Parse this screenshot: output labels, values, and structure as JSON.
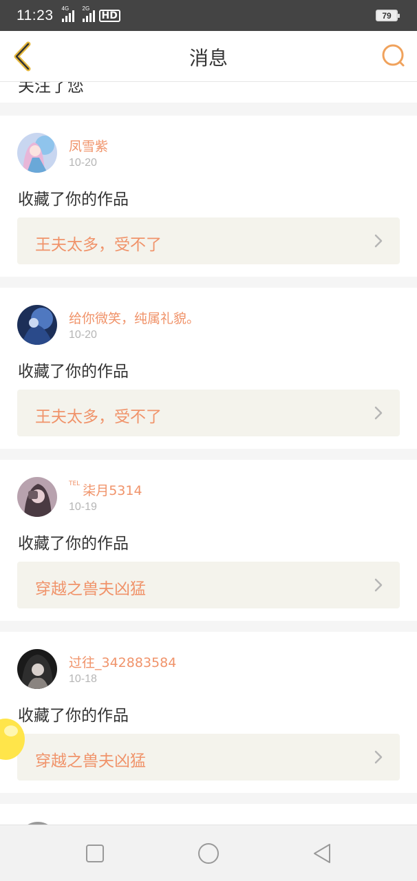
{
  "status_bar": {
    "time": "11:23",
    "signal1_label": "4G",
    "signal2_label": "2G",
    "hd_label": "HD",
    "battery": "79"
  },
  "nav": {
    "title": "消息",
    "back_icon": "back-chevron-icon",
    "search_icon": "search-icon",
    "accent_color": "#f0a25c"
  },
  "partial_message": {
    "action": "关注了您"
  },
  "messages": [
    {
      "avatar_icon": "avatar-anime-girl-blue",
      "username": "凤雪紫",
      "date": "10-20",
      "action": "收藏了你的作品",
      "work_title": "王夫太多，受不了"
    },
    {
      "avatar_icon": "avatar-dark-blue-art",
      "username": "给你微笑，纯属礼貌。",
      "date": "10-20",
      "action": "收藏了你的作品",
      "work_title": "王夫太多，受不了"
    },
    {
      "avatar_icon": "avatar-girl-photo",
      "username_prefix": "TEL",
      "username": "柒月5314",
      "date": "10-19",
      "action": "收藏了你的作品",
      "work_title": "穿越之兽夫凶猛"
    },
    {
      "avatar_icon": "avatar-dark-portrait",
      "username": "过往_342883584",
      "date": "10-18",
      "action": "收藏了你的作品",
      "work_title": "穿越之兽夫凶猛"
    }
  ],
  "system_nav": {
    "recent_icon": "square-recent-apps-icon",
    "home_icon": "circle-home-icon",
    "back_icon": "triangle-back-icon"
  },
  "colors": {
    "username": "#f0936a",
    "work_title": "#f0936a",
    "link_background": "#f4f3ec",
    "status_bar": "#444444"
  }
}
